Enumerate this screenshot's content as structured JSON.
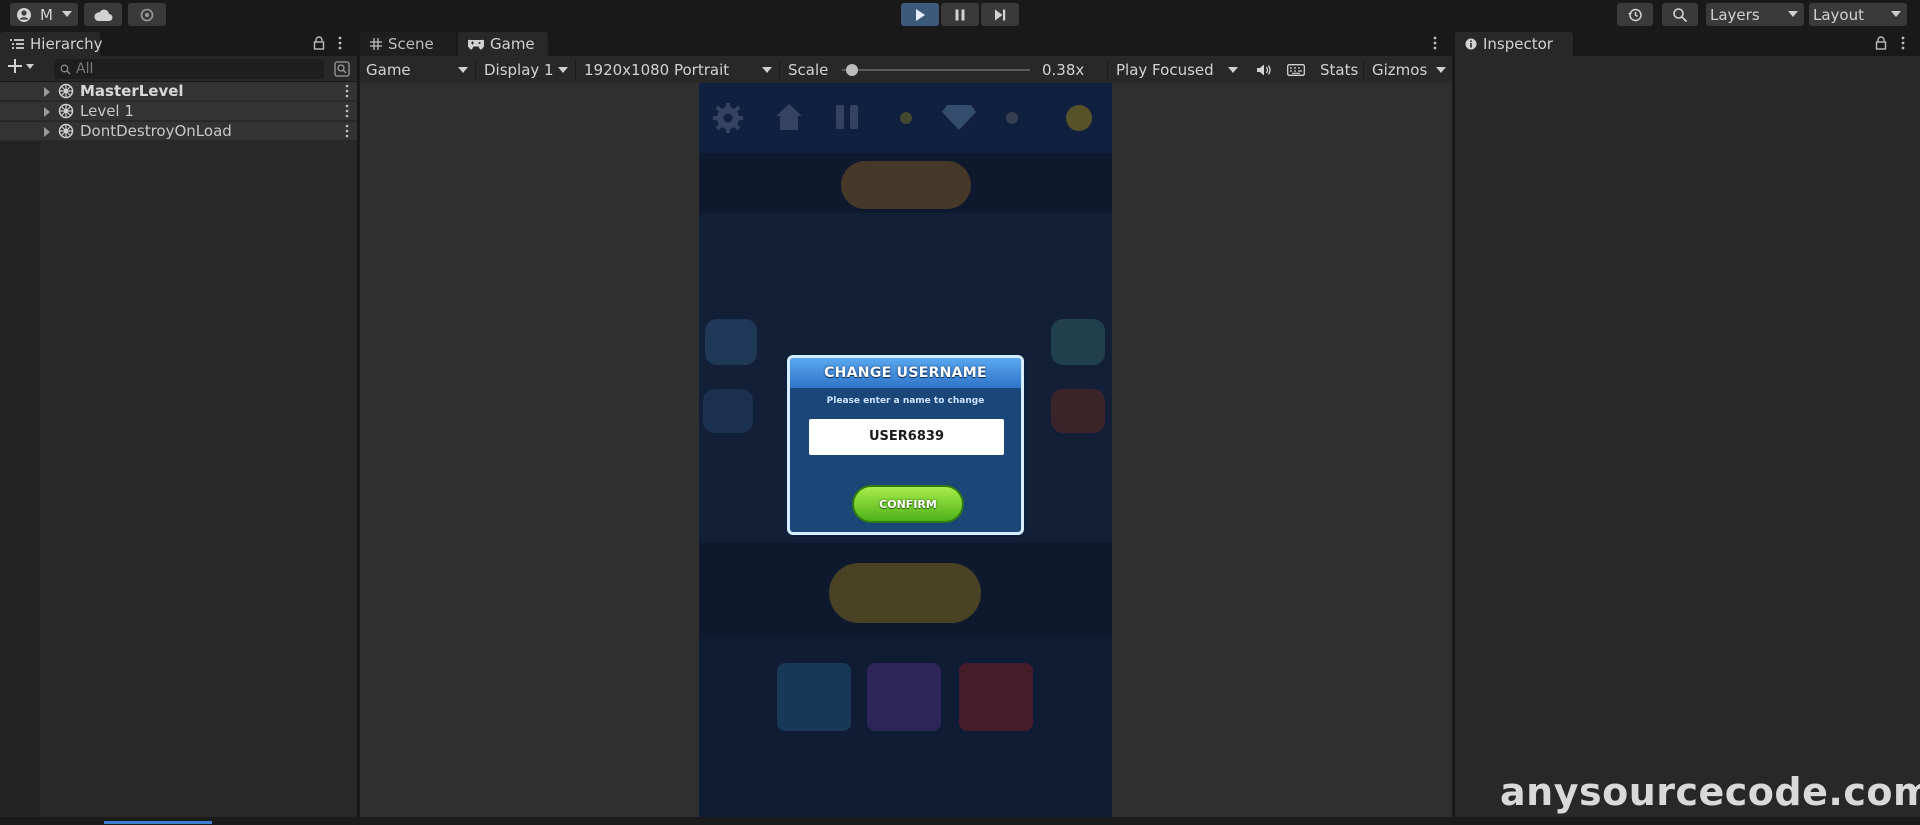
{
  "toolbar": {
    "account_label": "M",
    "layers_label": "Layers",
    "layout_label": "Layout"
  },
  "hierarchy": {
    "tab_label": "Hierarchy",
    "search_placeholder": "All",
    "items": [
      {
        "label": "MasterLevel",
        "bold": true
      },
      {
        "label": "Level 1",
        "bold": false
      },
      {
        "label": "DontDestroyOnLoad",
        "bold": false
      }
    ]
  },
  "center_tabs": {
    "scene_label": "Scene",
    "game_label": "Game"
  },
  "game_toolbar": {
    "view_mode": "Game",
    "display": "Display 1",
    "resolution": "1920x1080 Portrait",
    "scale_label": "Scale",
    "scale_value": "0.38x",
    "scale_fraction": 0.02,
    "play_mode": "Play Focused",
    "stats_label": "Stats",
    "gizmos_label": "Gizmos"
  },
  "dialog": {
    "title": "CHANGE USERNAME",
    "subtitle": "Please enter a name to change",
    "username_value": "USER6839",
    "confirm_label": "CONFIRM"
  },
  "inspector": {
    "tab_label": "Inspector"
  },
  "watermark": "anysourcecode.com",
  "colors": {
    "accent_blue": "#3d7fd0",
    "dialog_header": "#3d8ae0",
    "confirm_green": "#6cc82a"
  }
}
